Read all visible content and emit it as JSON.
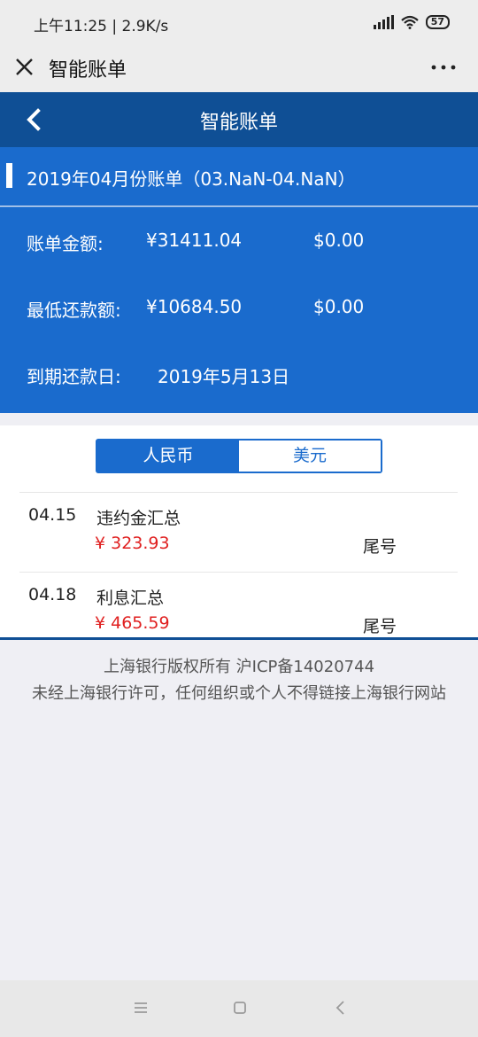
{
  "status_bar": {
    "time": "上午11:25 | 2.9K/s",
    "battery": "57",
    "icons": [
      "signal-icon",
      "wifi-icon",
      "battery-icon"
    ]
  },
  "wechat_bar": {
    "title": "智能账单",
    "close_icon": "close-icon",
    "more_icon": "more-icon"
  },
  "header": {
    "title": "智能账单",
    "back_icon": "back-icon"
  },
  "bill": {
    "title": "2019年04月份账单（03.NaN-04.NaN）",
    "amount_label": "账单金额:",
    "amount_rmb": "¥31411.04",
    "amount_usd": "$0.00",
    "min_label": "最低还款额:",
    "min_rmb": "¥10684.50",
    "min_usd": "$0.00",
    "due_label": "到期还款日:",
    "due_date": "2019年5月13日"
  },
  "tabs": [
    {
      "label": "人民币",
      "active": true
    },
    {
      "label": "美元",
      "active": false
    }
  ],
  "transactions": [
    {
      "date": "04.15",
      "name": "违约金汇总",
      "amount": "¥ 323.93",
      "tail": "尾号"
    },
    {
      "date": "04.18",
      "name": "利息汇总",
      "amount": "¥ 465.59",
      "tail": "尾号"
    }
  ],
  "footer": {
    "line1": "上海银行版权所有 沪ICP备14020744",
    "line2": "未经上海银行许可，任何组织或个人不得链接上海银行网站"
  },
  "colors": {
    "primary": "#1a6bcd",
    "header": "#0f4f95",
    "amount_red": "#e02020"
  },
  "nav_icons": [
    "menu-icon",
    "home-icon",
    "back-nav-icon"
  ]
}
